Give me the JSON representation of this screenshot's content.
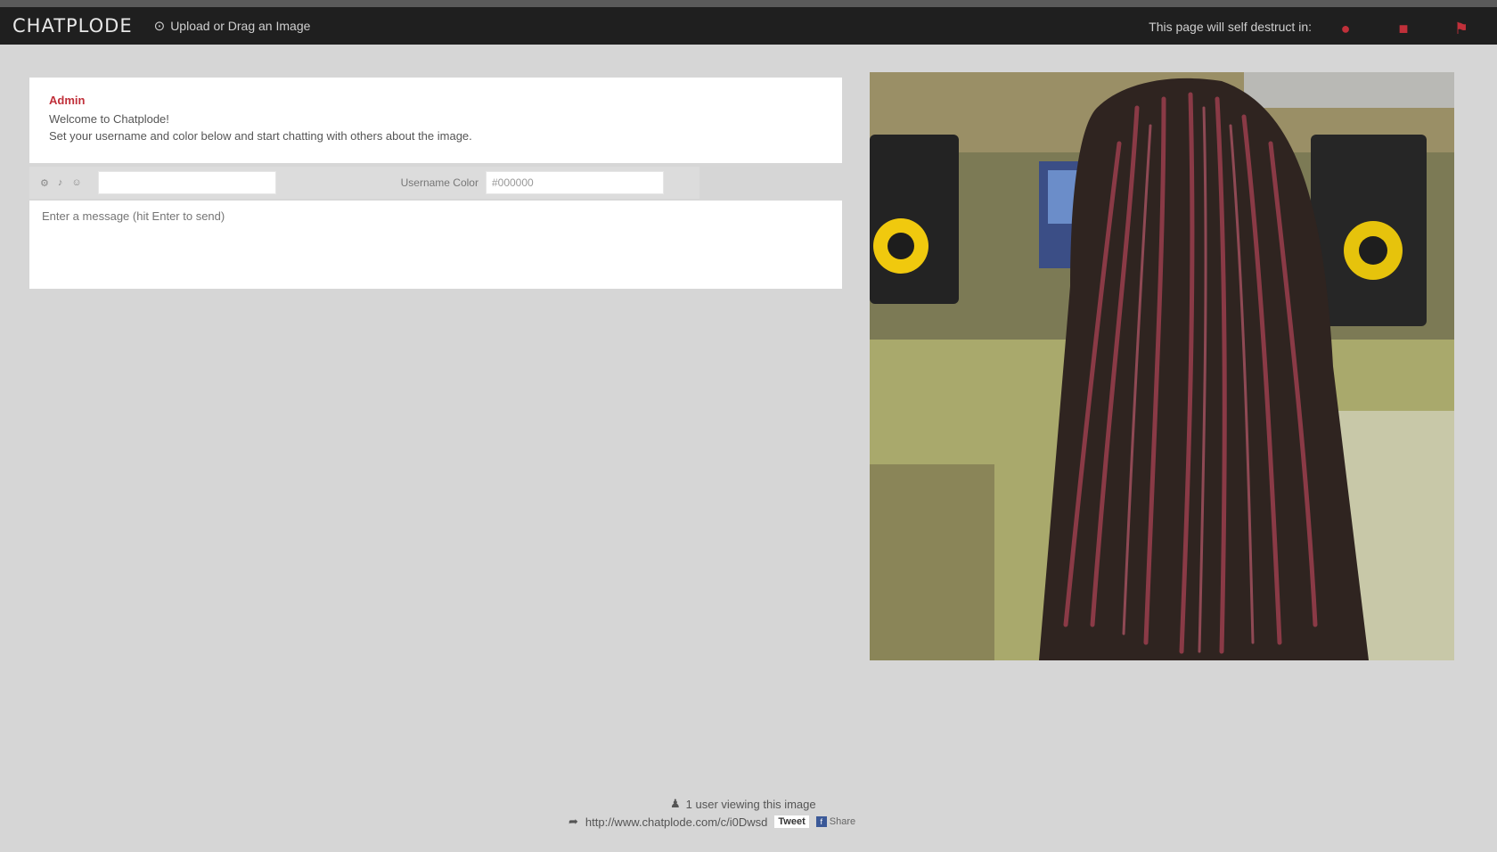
{
  "header": {
    "logo": "CHATPLODE",
    "upload_icon": "upload-icon",
    "upload_label": "Upload or Drag an Image",
    "self_destruct": "This page will self destruct in:",
    "icons": [
      "user-icon",
      "bookmark-icon",
      "flag-icon"
    ],
    "accent_color": "#c0303a"
  },
  "chat": {
    "messages": [
      {
        "author": "Admin",
        "line1": "Welcome to Chatplode!",
        "line2": "Set your username and color below and start chatting with others about the image.",
        "time": ""
      }
    ]
  },
  "controls": {
    "icons": [
      "settings-icon",
      "sound-icon",
      "emoji-icon"
    ],
    "name_placeholder": "",
    "color_label": "Username Color",
    "color_value": "#000000",
    "message_placeholder": "Enter a message (hit Enter to send)"
  },
  "image": {
    "description_icon": "photo"
  },
  "footer": {
    "viewing_icon": "user-icon",
    "viewing_text": "1 user viewing this image",
    "share_icon": "share-icon",
    "share_url": "http://www.chatplode.com/c/i0Dwsd",
    "tweet_label": "Tweet",
    "share_label": "Share"
  }
}
